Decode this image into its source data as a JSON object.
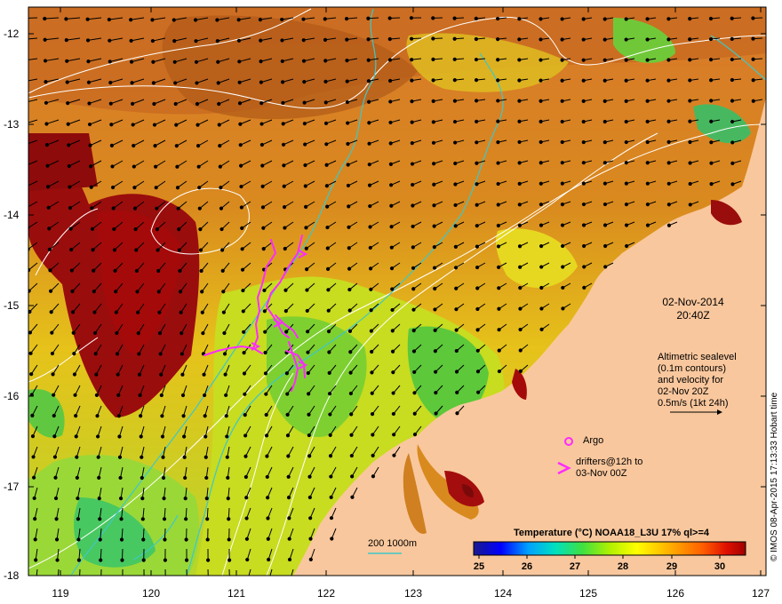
{
  "x_ticks": [
    "119",
    "120",
    "121",
    "122",
    "123",
    "124",
    "125",
    "126",
    "127"
  ],
  "y_ticks": [
    "-12",
    "-13",
    "-14",
    "-15",
    "-16",
    "-17",
    "-18"
  ],
  "date_line1": "02-Nov-2014",
  "date_line2": "20:40Z",
  "altimetry_note": [
    "Altimetric sealevel",
    "(0.1m contours)",
    "and velocity for",
    "02-Nov 20Z",
    "0.5m/s (1kt 24h)"
  ],
  "argo_label": "Argo",
  "drifters_label_1": "drifters@12h to",
  "drifters_label_2": "03-Nov 00Z",
  "depth_label": "200  1000m",
  "colorbar_title": "Temperature (°C) NOAA18_L3U 17% ql>=4",
  "colorbar_ticks": [
    "25",
    "26",
    "27",
    "28",
    "29",
    "30"
  ],
  "credit": "© IMOS 08-Apr-2015 17:13:33 Hobart time",
  "colors": {
    "land": "#f9c79d",
    "contour": "#ffffff",
    "bathymetry": "#3ec8c8",
    "drifter": "#ff2bff",
    "arrow": "#000000"
  },
  "colorbar_stops": [
    "#1a1a8c",
    "#0000ff",
    "#00a0ff",
    "#00e0c0",
    "#40e040",
    "#b0f000",
    "#ffff00",
    "#ffb000",
    "#ff6000",
    "#e01000",
    "#a00000"
  ]
}
